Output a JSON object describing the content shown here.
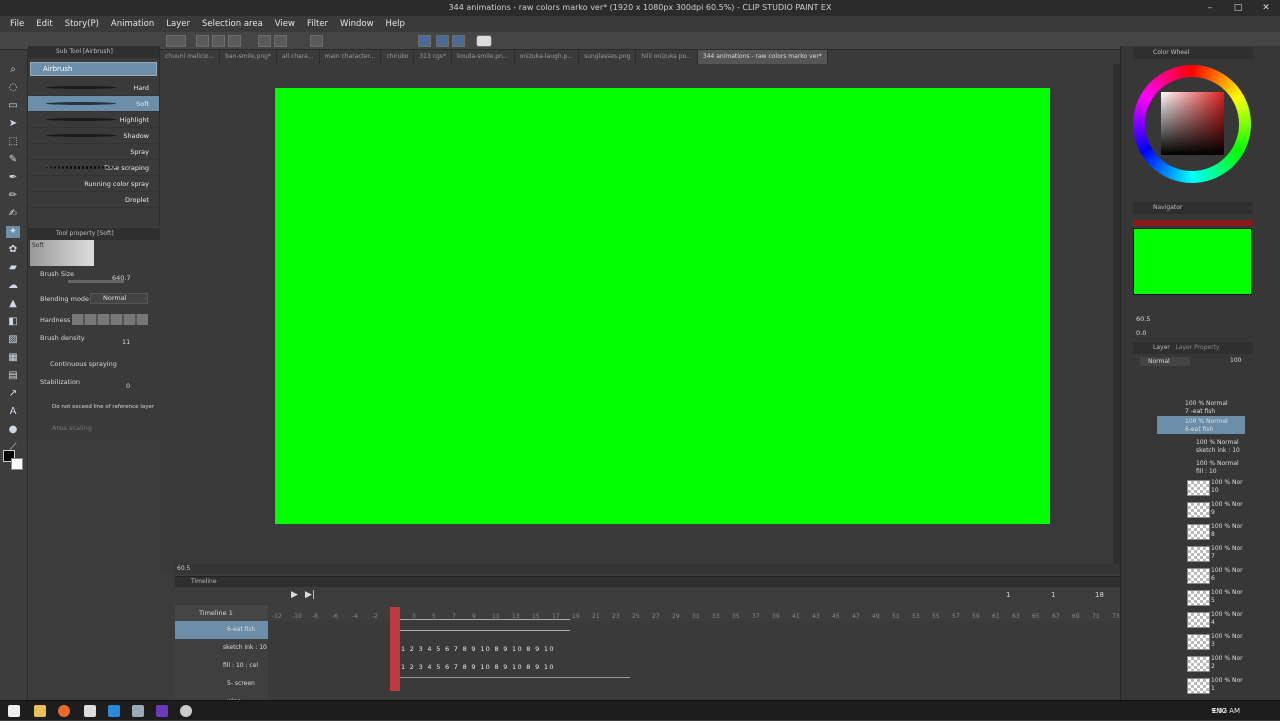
{
  "window": {
    "title": "344 animations - raw colors marko ver* (1920 x 1080px 300dpi 60.5%) - CLIP STUDIO PAINT EX"
  },
  "menu": [
    "File",
    "Edit",
    "Story(P)",
    "Animation",
    "Layer",
    "Selection area",
    "View",
    "Filter",
    "Window",
    "Help"
  ],
  "tabs": [
    "chuuni malicio...",
    "ban-smile.png*",
    "all chara...",
    "main character...",
    "chiruko",
    "313 cgs*",
    "kouda-smile.pn...",
    "onizuka-laugh.p...",
    "sunglasses.png",
    "hiiii onizuka po...",
    "344 animations - raw colors marko ver*"
  ],
  "subtool": {
    "panel_title": "Sub Tool [Airbrush]",
    "group": "Airbrush",
    "brushes": [
      "Hard",
      "Soft",
      "Highlight",
      "Shadow",
      "Spray",
      "Tone scraping",
      "Running color spray",
      "Droplet"
    ],
    "selected": "Soft"
  },
  "toolprop": {
    "panel_title": "Tool property [Soft]",
    "preview_label": "Soft",
    "brush_size_label": "Brush Size",
    "brush_size": "640.7",
    "blending_label": "Blending mode",
    "blending_value": "Normal",
    "hardness_label": "Hardness",
    "density_label": "Brush density",
    "density_value": "11",
    "continuous": "Continuous spraying",
    "stabilization_label": "Stabilization",
    "stabilization_value": "0",
    "do_not_exceed": "Do not exceed line of reference layer",
    "area_scaling": "Area scaling"
  },
  "canvas": {
    "zoom": "60.5",
    "color": "#00ff00"
  },
  "timeline": {
    "panel_title": "Timeline",
    "name": "Timeline 1",
    "frame_counter": [
      "1",
      "1",
      "18"
    ],
    "ruler_ticks": [
      "-12",
      "-10",
      "-8",
      "-6",
      "-4",
      "-2",
      "1",
      "3",
      "5",
      "7",
      "9",
      "11",
      "13",
      "15",
      "17",
      "19",
      "21",
      "23",
      "25",
      "27",
      "29",
      "31",
      "33",
      "35",
      "37",
      "39",
      "41",
      "43",
      "45",
      "47",
      "49",
      "51",
      "53",
      "55",
      "57",
      "59",
      "61",
      "63",
      "65",
      "67",
      "69",
      "71",
      "73"
    ],
    "rows": [
      {
        "label": "6-eat fish",
        "frames": ""
      },
      {
        "label": "sketch ink : 10",
        "frames": "1 2 3 4 5 6 7 8 9 10 8 9 10 8 9 10"
      },
      {
        "label": "fill : 10 : cel",
        "frames": "1 2 3 4 5 6 7 8 9 10 8 9 10 8 9 10"
      },
      {
        "label": "5- screen wipe",
        "frames": ""
      }
    ]
  },
  "right": {
    "colorwheel_title": "Color Wheel",
    "navigator_title": "Navigator",
    "nav_zoom": "60.5",
    "nav_angle": "0.0",
    "layer_title": "Layer",
    "layer_prop_title": "Layer Property",
    "blend_mode": "Normal",
    "opacity": "100",
    "layers": [
      {
        "mode": "100 % Normal",
        "name": "7 -eat fish"
      },
      {
        "mode": "100 % Normal",
        "name": "6-eat fish"
      },
      {
        "mode": "100 % Normal",
        "name": "sketch ink : 10"
      },
      {
        "mode": "100 % Normal",
        "name": "fill : 10"
      },
      {
        "mode": "100 % Nor",
        "name": "10"
      },
      {
        "mode": "100 % Nor",
        "name": "9"
      },
      {
        "mode": "100 % Nor",
        "name": "8"
      },
      {
        "mode": "100 % Nor",
        "name": "7"
      },
      {
        "mode": "100 % Nor",
        "name": "6"
      },
      {
        "mode": "100 % Nor",
        "name": "5"
      },
      {
        "mode": "100 % Nor",
        "name": "4"
      },
      {
        "mode": "100 % Nor",
        "name": "3"
      },
      {
        "mode": "100 % Nor",
        "name": "2"
      },
      {
        "mode": "100 % Nor",
        "name": "1"
      }
    ]
  },
  "taskbar": {
    "lang": "ENG",
    "time": "9:02 AM"
  }
}
